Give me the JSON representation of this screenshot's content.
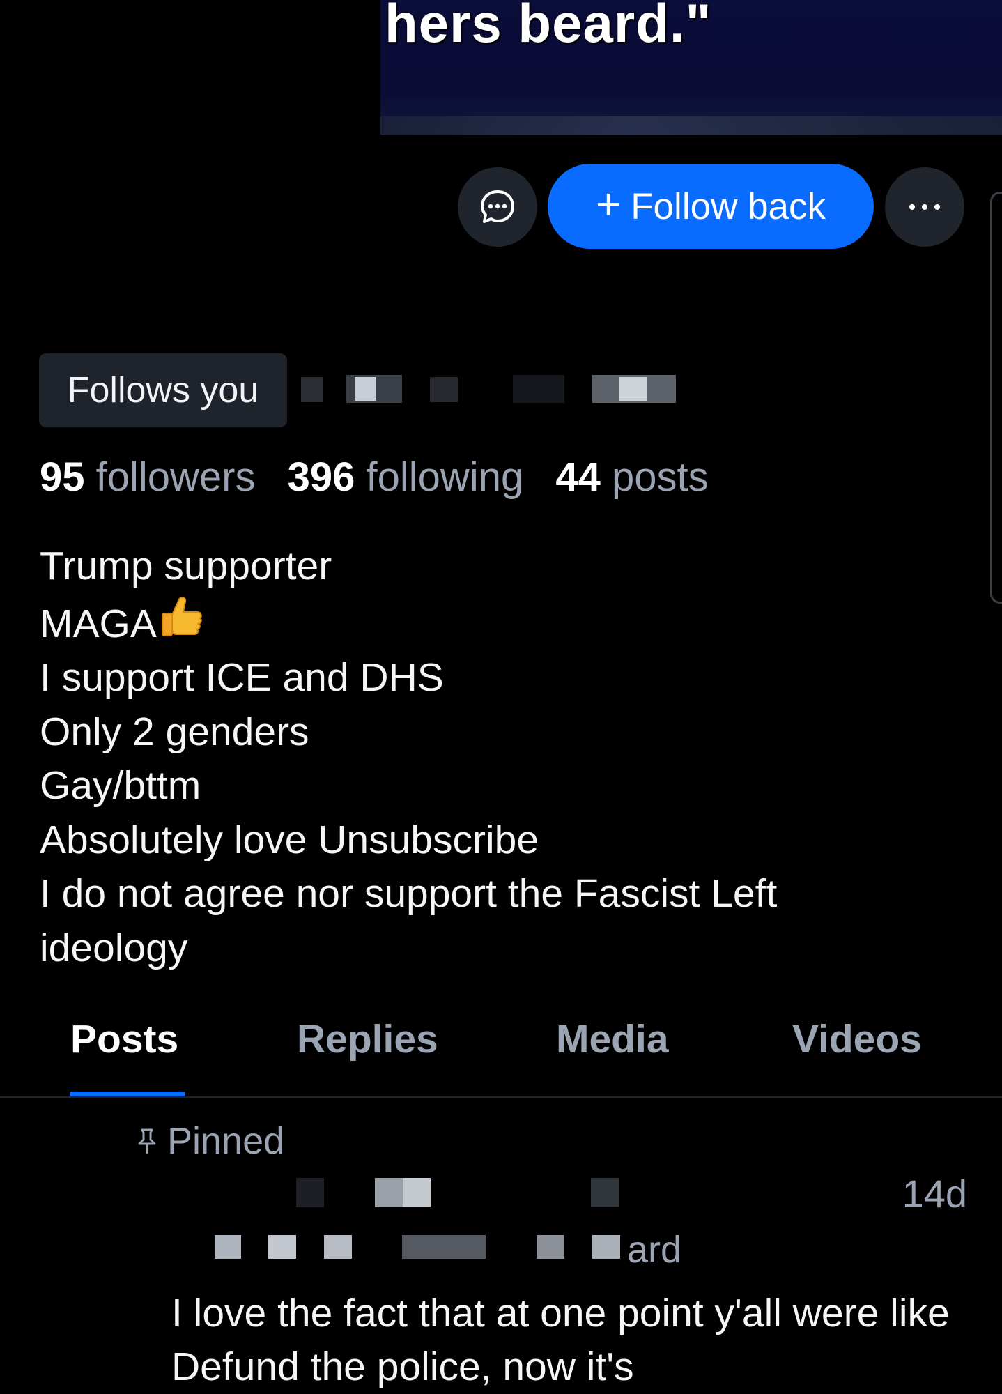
{
  "banner": {
    "caption": "hers beard.\""
  },
  "actions": {
    "message_icon": "chat-bubble-icon",
    "follow_label": "Follow back",
    "follow_plus": "+",
    "more_icon": "ellipsis-icon"
  },
  "profile": {
    "follows_you": "Follows you"
  },
  "stats": {
    "followers_count": "95",
    "followers_label": "followers",
    "following_count": "396",
    "following_label": "following",
    "posts_count": "44",
    "posts_label": "posts"
  },
  "bio": {
    "lines": [
      "Trump supporter",
      "MAGA",
      "I support ICE and DHS",
      "Only 2 genders",
      "Gay/bttm",
      "Absolutely love Unsubscribe",
      "I do not agree nor support the Fascist Left",
      "ideology"
    ]
  },
  "tabs": [
    {
      "label": "Posts",
      "active": true
    },
    {
      "label": "Replies",
      "active": false
    },
    {
      "label": "Media",
      "active": false
    },
    {
      "label": "Videos",
      "active": false
    }
  ],
  "post": {
    "pinned_label": "Pinned",
    "time": "14d",
    "fragment": "ard",
    "text": "I love the fact that at one point y'all were like Defund the police, now it's"
  },
  "colors": {
    "accent": "#0a6cff",
    "background": "#000000",
    "muted_text": "#9aa4b2",
    "chip_background": "#1e232c"
  }
}
